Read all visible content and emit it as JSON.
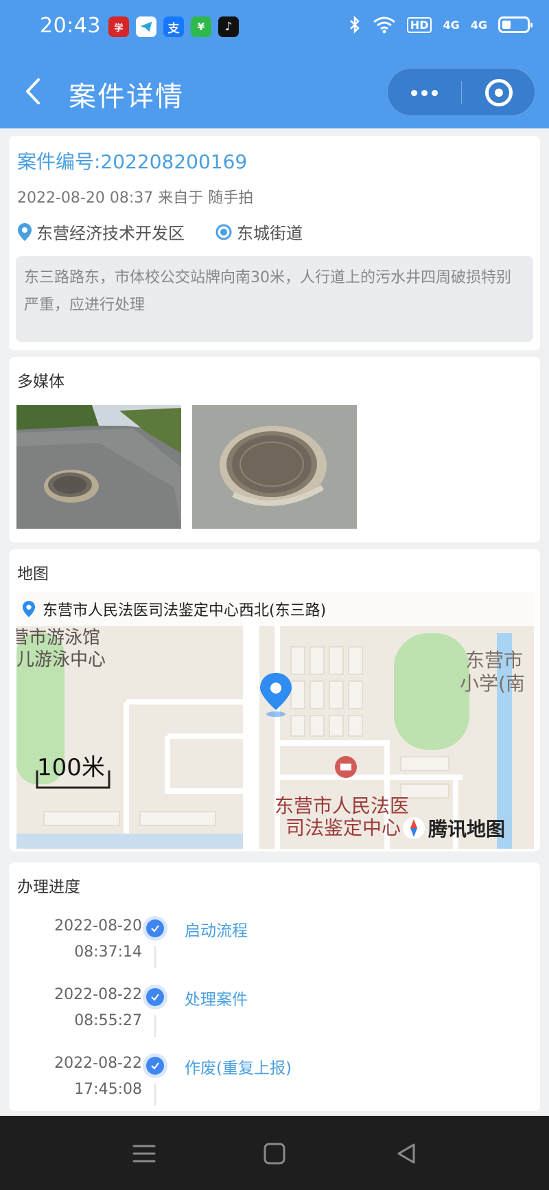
{
  "status_bar": {
    "time": "20:43",
    "app_icons": [
      "xuexi-icon",
      "telegram-icon",
      "alipay-icon",
      "wechat-pay-icon",
      "tiktok-icon"
    ],
    "network_hd": "HD",
    "network_4g_1": "4G",
    "network_4g_2": "4G"
  },
  "header": {
    "title": "案件详情",
    "accent_color": "#4f9bee"
  },
  "case": {
    "number": "案件编号:202208200169",
    "meta": "2022-08-20 08:37 来自于 随手拍",
    "district": "东营经济技术开发区",
    "street": "东城街道",
    "description": "东三路路东，市体校公交站牌向南30米，人行道上的污水井四周破损特别严重，应进行处理"
  },
  "media": {
    "title": "多媒体"
  },
  "map": {
    "title": "地图",
    "address": "东营市人民法医司法鉴定中心西北(东三路)",
    "label_swimming_1": "营市游泳馆",
    "label_swimming_2": "儿游泳中心",
    "label_school_1": "东营市",
    "label_school_2": "小学(南",
    "label_center_1": "东营市人民法医",
    "label_center_2": "司法鉴定中心",
    "scale": "100米",
    "brand": "腾讯地图"
  },
  "progress": {
    "title": "办理进度",
    "steps": [
      {
        "date": "2022-08-20",
        "time": "08:37:14",
        "label": "启动流程"
      },
      {
        "date": "2022-08-22",
        "time": "08:55:27",
        "label": "处理案件"
      },
      {
        "date": "2022-08-22",
        "time": "17:45:08",
        "label": "作废(重复上报)"
      }
    ]
  }
}
